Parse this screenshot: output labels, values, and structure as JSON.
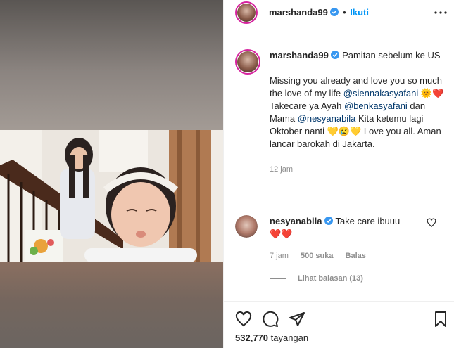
{
  "post": {
    "username": "marshanda99",
    "follow_label": "Ikuti",
    "dot": "•",
    "caption_title": "Pamitan sebelum ke US",
    "caption_p1_a": "Missing you already and love you so much the love of my life ",
    "mention_sienna": "@siennakasyafani",
    "emoji_1": "🌞❤️",
    "caption_p1_b": " Takecare ya Ayah ",
    "mention_ben": "@benkasyafani",
    "caption_p1_c": " dan Mama ",
    "mention_nesya": "@nesyanabila",
    "caption_p1_d": " Kita ketemu lagi Oktober nanti ",
    "emoji_2": "💛😢💛",
    "caption_p1_e": " Love you all. Aman lancar barokah di Jakarta.",
    "timestamp": "12 jam",
    "views_count": "532,770",
    "views_label": "tayangan"
  },
  "comment": {
    "username": "nesyanabila",
    "text": "Take care ibuuu",
    "emoji": "❤️❤️",
    "time": "7 jam",
    "likes": "500 suka",
    "reply_label": "Balas",
    "view_replies": "Lihat balasan (13)"
  },
  "icons": {
    "verified": "verified-badge-icon",
    "more": "more-options-icon",
    "like": "heart-icon",
    "comment": "comment-icon",
    "share": "paper-plane-icon",
    "save": "bookmark-icon",
    "comment_like": "small-heart-icon"
  },
  "colors": {
    "accent": "#0095f6",
    "verified": "#3897f0",
    "link": "#00376b",
    "muted": "#8e8e8e",
    "text": "#262626"
  }
}
